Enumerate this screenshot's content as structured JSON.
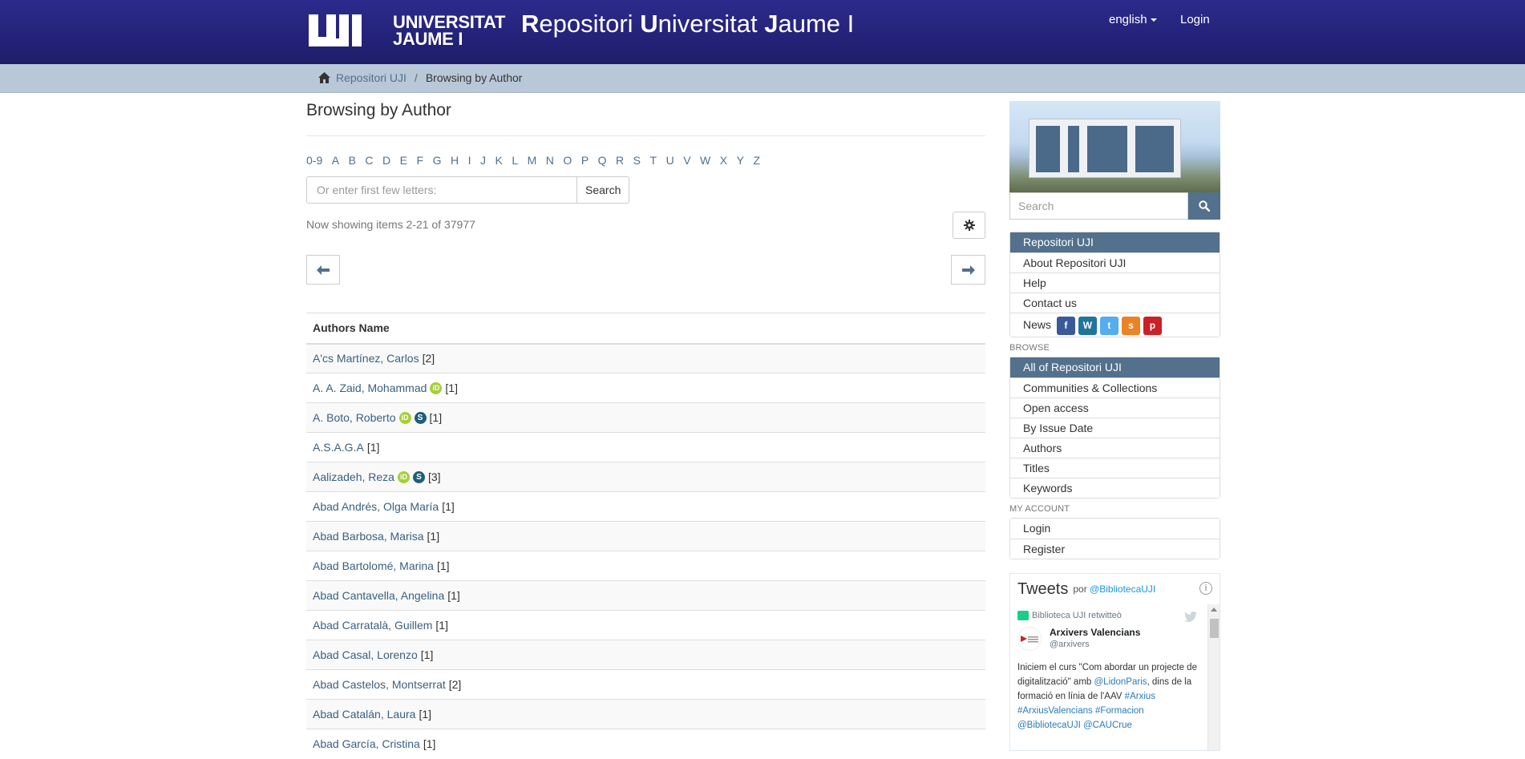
{
  "header": {
    "logo_line1": "UNIVERSITAT",
    "logo_line2": "JAUME I",
    "site_title_r": "R",
    "site_title_rest1": "epositori ",
    "site_title_u": "U",
    "site_title_rest2": "niversitat ",
    "site_title_j": "J",
    "site_title_rest3": "aume I",
    "language": "english",
    "login": "Login"
  },
  "breadcrumb": {
    "home": "Repositori UJI",
    "separator": "/",
    "current": "Browsing by Author"
  },
  "main": {
    "title": "Browsing by Author",
    "letters": [
      "0-9",
      "A",
      "B",
      "C",
      "D",
      "E",
      "F",
      "G",
      "H",
      "I",
      "J",
      "K",
      "L",
      "M",
      "N",
      "O",
      "P",
      "Q",
      "R",
      "S",
      "T",
      "U",
      "V",
      "W",
      "X",
      "Y",
      "Z"
    ],
    "browse_placeholder": "Or enter first few letters:",
    "browse_button": "Search",
    "showing": "Now showing items 2-21 of 37977",
    "table_header": "Authors Name",
    "authors": [
      {
        "name": "A'cs Martínez, Carlos",
        "count": "[2]",
        "orcid": false,
        "scopus": false
      },
      {
        "name": "A. A. Zaid, Mohammad",
        "count": "[1]",
        "orcid": true,
        "scopus": false
      },
      {
        "name": "A. Boto, Roberto",
        "count": "[1]",
        "orcid": true,
        "scopus": true
      },
      {
        "name": "A.S.A.G.A",
        "count": "[1]",
        "orcid": false,
        "scopus": false
      },
      {
        "name": "Aalizadeh, Reza",
        "count": "[3]",
        "orcid": true,
        "scopus": true
      },
      {
        "name": "Abad Andrés, Olga María",
        "count": "[1]",
        "orcid": false,
        "scopus": false
      },
      {
        "name": "Abad Barbosa, Marisa",
        "count": "[1]",
        "orcid": false,
        "scopus": false
      },
      {
        "name": "Abad Bartolomé, Marina",
        "count": "[1]",
        "orcid": false,
        "scopus": false
      },
      {
        "name": "Abad Cantavella, Angelina",
        "count": "[1]",
        "orcid": false,
        "scopus": false
      },
      {
        "name": "Abad Carratalà, Guillem",
        "count": "[1]",
        "orcid": false,
        "scopus": false
      },
      {
        "name": "Abad Casal, Lorenzo",
        "count": "[1]",
        "orcid": false,
        "scopus": false
      },
      {
        "name": "Abad Castelos, Montserrat",
        "count": "[2]",
        "orcid": false,
        "scopus": false
      },
      {
        "name": "Abad Catalán, Laura",
        "count": "[1]",
        "orcid": false,
        "scopus": false
      },
      {
        "name": "Abad García, Cristina",
        "count": "[1]",
        "orcid": false,
        "scopus": false
      }
    ]
  },
  "sidebar": {
    "search_placeholder": "Search",
    "repo_menu": {
      "header": "Repositori UJI",
      "items": [
        "About Repositori UJI",
        "Help",
        "Contact us"
      ],
      "news": "News"
    },
    "browse_heading": "BROWSE",
    "browse_menu": {
      "header": "All of Repositori UJI",
      "items": [
        "Communities & Collections",
        "Open access",
        "By Issue Date",
        "Authors",
        "Titles",
        "Keywords"
      ]
    },
    "account_heading": "MY ACCOUNT",
    "account_menu": [
      "Login",
      "Register"
    ],
    "social_icons": [
      "facebook-icon",
      "wordpress-icon",
      "twitter-icon",
      "slideshare-icon",
      "pinterest-icon"
    ]
  },
  "tweets": {
    "title": "Tweets",
    "by_prefix": "por",
    "by_handle": "@BibliotecaUJI",
    "retweet_label": "Biblioteca UJI retwitteò",
    "author_name": "Arxivers Valencians",
    "author_handle": "@arxivers",
    "text_1": "Iniciem el curs \"Com abordar un projecte de digitalització\" amb ",
    "mention_1": "@LidonParis",
    "text_2": ", dins de la formació en línia de l'AAV ",
    "tag_1": "#Arxius",
    "tag_2": "#ArxiusValencians",
    "tag_3": "#Formacion",
    "mention_2": "@BibliotecaUJI",
    "mention_3": "@CAUCrue"
  },
  "colors": {
    "header_bg": "#2c2b8c",
    "breadcrumb_bg": "#b8c8d8",
    "accent": "#53708c",
    "link": "#3a5f80",
    "orcid": "#a6ce39",
    "scopus": "#1f5f78"
  }
}
